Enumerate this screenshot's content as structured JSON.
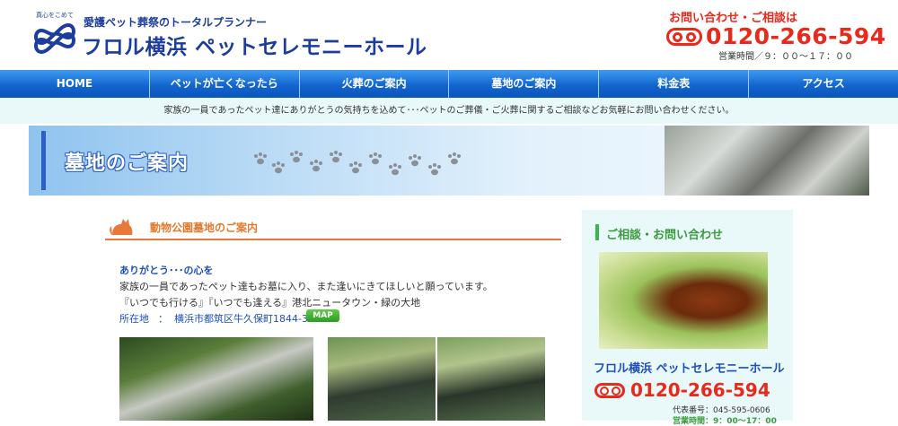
{
  "header": {
    "logo_tagline_top": "真心をこめて",
    "logo_sub": "愛護ペット葬祭のトータルプランナー",
    "logo_name": "フロル横浜 ペットセレモニーホール",
    "contact_title": "お問い合わせ・ご相談は",
    "phone": "0120-266-594",
    "hours": "営業時間／９：００～１７：００"
  },
  "nav": {
    "items": [
      "HOME",
      "ペットが亡くなったら",
      "火葬のご案内",
      "墓地のご案内",
      "料金表",
      "アクセス"
    ]
  },
  "announcement": "家族の一員であったペット達にありがとうの気持ちを込めて･･･ペットのご葬儀・ご火葬に関するご相談などお気軽にお問い合わせください。",
  "banner": {
    "title": "墓地のご案内"
  },
  "section": {
    "title": "動物公園墓地のご案内"
  },
  "content": {
    "heading": "ありがとう･･･の心を",
    "line1": "家族の一員であったペット達もお墓に入り、また逢いにきてほしいと願っています。",
    "line2": "『いつでも行ける』『いつでも逢える』港北ニュータウン・緑の大地",
    "location_label": "所在地",
    "location_sep": "：",
    "location_value": "横浜市都筑区牛久保町1844-3",
    "map_button": "MAP"
  },
  "sidebar": {
    "title": "ご相談・お問い合わせ",
    "name": "フロル横浜 ペットセレモニーホール",
    "phone": "0120-266-594",
    "rep": "代表番号：045-595-0606",
    "hours": "営業時間：9：00～17：00"
  },
  "colors": {
    "brand_blue": "#1c3d9b",
    "accent_red": "#e8291c",
    "nav_blue": "#1266cf",
    "section_orange": "#e07a2e",
    "side_green": "#3a9c3f"
  }
}
